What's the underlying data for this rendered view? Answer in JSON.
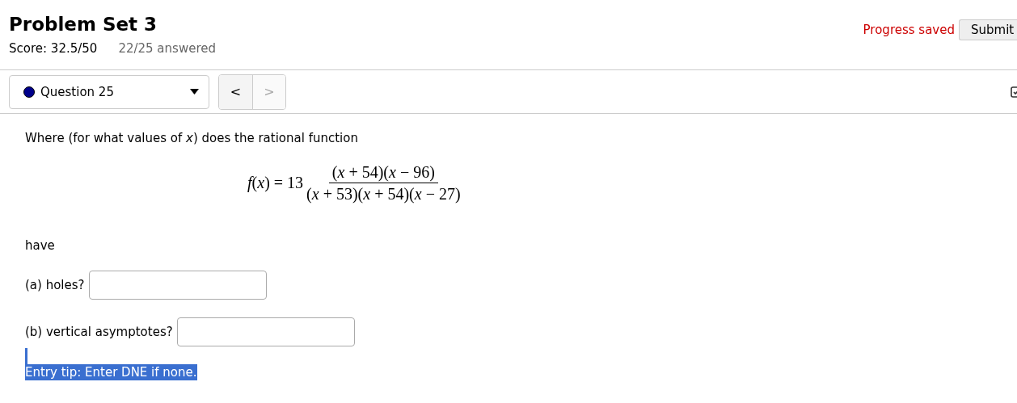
{
  "header": {
    "title": "Problem Set 3",
    "score": "Score: 32.5/50",
    "answered": "22/25 answered",
    "save_status": "Progress saved",
    "submit_button": "Submit"
  },
  "navigation": {
    "question_select": {
      "label": "Question 25",
      "color": "#00008b"
    },
    "prev_button": {
      "label": "<",
      "disabled": false
    },
    "next_button": {
      "label": ">",
      "disabled": true
    }
  },
  "question": {
    "prompt": "Where (for what values of *x*) does the rational function",
    "formula": {
      "lhs": "f(x) = 13",
      "numerator": "(x + 54)(x − 96)",
      "denominator": "(x + 53)(x + 54)(x − 27)"
    },
    "continuation": "have",
    "parts": [
      {
        "label": "(a) holes?"
      },
      {
        "label": "(b) vertical asymptotes?"
      }
    ],
    "tip": {
      "text": "Entry tip: Enter DNE if none.",
      "highlighted": true
    }
  }
}
